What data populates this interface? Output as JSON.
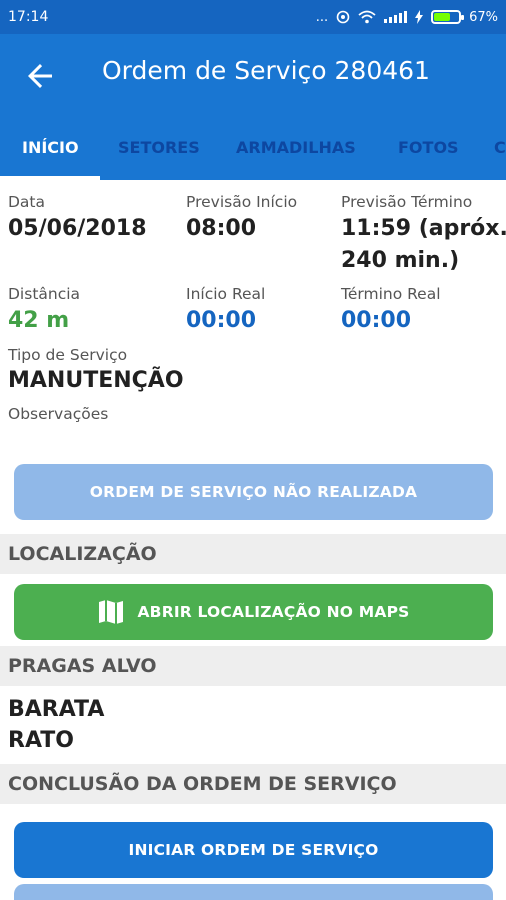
{
  "status": {
    "time": "17:14",
    "dots": "...",
    "battery_pct": "67%",
    "battery_level": 0.67
  },
  "header": {
    "title": "Ordem de Serviço 280461",
    "back_icon": "arrow-left-icon"
  },
  "tabs": [
    {
      "label": "INÍCIO",
      "active": true
    },
    {
      "label": "SETORES"
    },
    {
      "label": "ARMADILHAS"
    },
    {
      "label": "FOTOS"
    },
    {
      "label": "C"
    }
  ],
  "info": {
    "data_label": "Data",
    "data_value": "05/06/2018",
    "previsao_inicio_label": "Previsão Início",
    "previsao_inicio_value": "08:00",
    "previsao_termino_label": "Previsão Término",
    "previsao_termino_value_line1": "11:59 (apróx.",
    "previsao_termino_value_line2": "240 min.)",
    "distancia_label": "Distância",
    "distancia_value": "42 m",
    "inicio_real_label": "Início Real",
    "inicio_real_value": "00:00",
    "termino_real_label": "Término Real",
    "termino_real_value": "00:00",
    "tipo_label": "Tipo de Serviço",
    "tipo_value": "MANUTENÇÃO",
    "observacoes_label": "Observações"
  },
  "buttons": {
    "nao_realizada": "ORDEM DE SERVIÇO NÃO REALIZADA",
    "abrir_maps": "ABRIR LOCALIZAÇÃO NO MAPS",
    "iniciar": "INICIAR ORDEM DE SERVIÇO"
  },
  "sections": {
    "localizacao": "LOCALIZAÇÃO",
    "pragas": "PRAGAS ALVO",
    "conclusao": "CONCLUSÃO DA ORDEM DE SERVIÇO"
  },
  "pragas": [
    "BARATA",
    "RATO"
  ],
  "colors": {
    "primary": "#1976d2",
    "status_bar": "#1565c0",
    "green": "#4caf50",
    "disabled_button": "#90b8e8"
  }
}
